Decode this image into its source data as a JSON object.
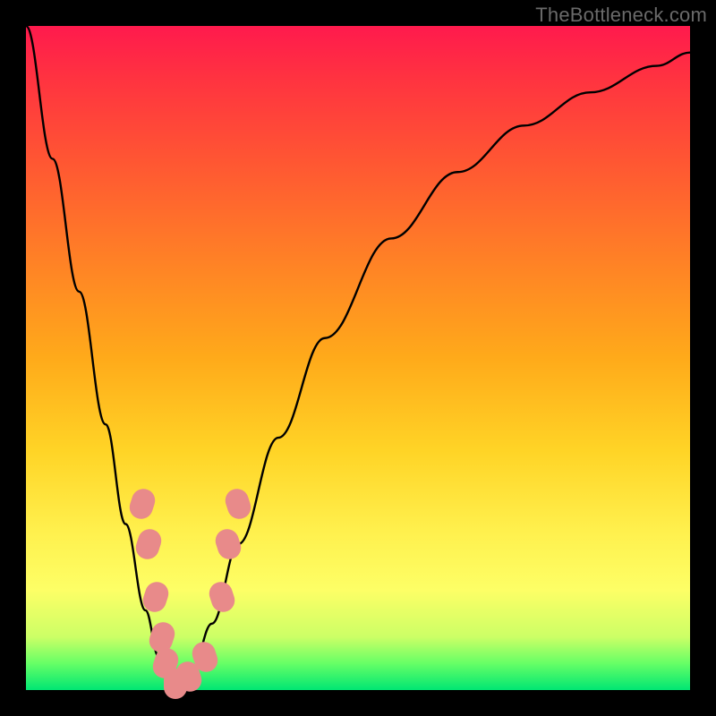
{
  "watermark": "TheBottleneck.com",
  "chart_data": {
    "type": "line",
    "title": "",
    "xlabel": "",
    "ylabel": "",
    "xlim": [
      0,
      100
    ],
    "ylim": [
      0,
      100
    ],
    "gradient_background": {
      "top": "#ff1a4d",
      "middle": "#fff04d",
      "bottom": "#00e673"
    },
    "series": [
      {
        "name": "curve",
        "x": [
          0,
          4,
          8,
          12,
          15,
          18,
          20,
          22,
          22.8,
          25,
          28,
          32,
          38,
          45,
          55,
          65,
          75,
          85,
          95,
          100
        ],
        "y": [
          100,
          80,
          60,
          40,
          25,
          12,
          5,
          1,
          0,
          3,
          10,
          22,
          38,
          53,
          68,
          78,
          85,
          90,
          94,
          96
        ]
      }
    ],
    "markers": [
      {
        "x": 17.5,
        "y": 28
      },
      {
        "x": 18.5,
        "y": 22
      },
      {
        "x": 19.5,
        "y": 14
      },
      {
        "x": 20.5,
        "y": 8
      },
      {
        "x": 21.0,
        "y": 4
      },
      {
        "x": 22.5,
        "y": 1
      },
      {
        "x": 24.5,
        "y": 2
      },
      {
        "x": 27.0,
        "y": 5
      },
      {
        "x": 29.5,
        "y": 14
      },
      {
        "x": 30.5,
        "y": 22
      },
      {
        "x": 32.0,
        "y": 28
      }
    ]
  }
}
